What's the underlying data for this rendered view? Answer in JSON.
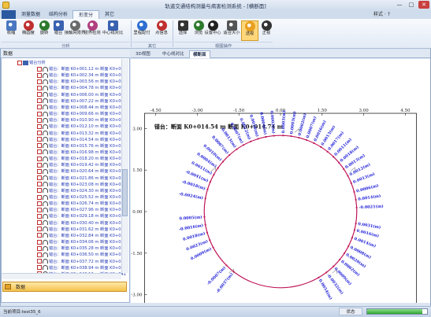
{
  "window": {
    "title": "轨道交通结构测量与病害检测系统 - [横断面]",
    "min_label": "—",
    "max_label": "□",
    "close_label": "✕"
  },
  "ribbon": {
    "file_tab": "",
    "tabs": [
      "测量数据",
      "结构分析",
      "形变分析",
      "其它"
    ],
    "active_tab": 2,
    "style_label": "样式 · ?",
    "groups": [
      "分析",
      "其它",
      "视图操作"
    ],
    "buttons": [
      {
        "label": "收缩",
        "icon": "shrink-icon",
        "color": "#4a78c0"
      },
      {
        "label": "椭圆度",
        "icon": "ellipse-icon",
        "color": "#c03030"
      },
      {
        "label": "旋转",
        "icon": "rotate-icon",
        "color": "#2d7a2d"
      },
      {
        "label": "错台",
        "icon": "offset-icon",
        "color": "#3a62b0"
      },
      {
        "label": "接触网限界",
        "icon": "catenary-icon",
        "color": "#6b6b6b"
      },
      {
        "label": "侵界检测",
        "icon": "clearance-icon",
        "color": "#b04080"
      },
      {
        "label": "中心线对比",
        "icon": "centerline-icon",
        "color": "#3a62b0"
      },
      {
        "label": "里程配付",
        "icon": "mileage-flag-icon",
        "color": "#2e6fd0"
      },
      {
        "label": "点信息",
        "icon": "point-info-icon",
        "color": "#c03030"
      },
      {
        "label": "选择",
        "icon": "select-cursor-icon",
        "color": "#333333"
      },
      {
        "label": "浏览",
        "icon": "pan-icon",
        "color": "#2d7a2d"
      },
      {
        "label": "设置中心",
        "icon": "set-center-icon",
        "color": "#222222"
      },
      {
        "label": "适合大小",
        "icon": "zoom-fit-icon",
        "color": "#555555"
      },
      {
        "label": "透视",
        "icon": "perspective-icon",
        "color": "#e8a020"
      },
      {
        "label": "正视",
        "icon": "front-view-icon",
        "color": "#333333"
      }
    ]
  },
  "left_panel": {
    "header": "数据",
    "root_label": "错台分析",
    "items": [
      "错台：断面 K0+001.12 m 断面 K0+002",
      "错台：断面 K0+002.34 m 断面 K0+003",
      "错台：断面 K0+003.56 m 断面 K0+004",
      "错台：断面 K0+004.78 m 断面 K0+006",
      "错台：断面 K0+006.00 m 断面 K0+007",
      "错台：断面 K0+007.22 m 断面 K0+008",
      "错台：断面 K0+008.44 m 断面 K0+009",
      "错台：断面 K0+009.66 m 断面 K0+010",
      "错台：断面 K0+010.90 m 断面 K0+012",
      "错台：断面 K0+012.10 m 断面 K0+013",
      "错台：断面 K0+013.32 m 断面 K0+014",
      "错台：断面 K0+014.54 m 断面 K0+015",
      "错台：断面 K0+015.76 m 断面 K0+016",
      "错台：断面 K0+016.98 m 断面 K0+018",
      "错台：断面 K0+018.20 m 断面 K0+019",
      "错台：断面 K0+019.42 m 断面 K0+020",
      "错台：断面 K0+020.64 m 断面 K0+021",
      "错台：断面 K0+021.86 m 断面 K0+023",
      "错台：断面 K0+023.08 m 断面 K0+024",
      "错台：断面 K0+024.30 m 断面 K0+025",
      "错台：断面 K0+025.52 m 断面 K0+026",
      "错台：断面 K0+026.74 m 断面 K0+027",
      "错台：断面 K0+027.96 m 断面 K0+029",
      "错台：断面 K0+029.18 m 断面 K0+030",
      "错台：断面 K0+030.40 m 断面 K0+031",
      "错台：断面 K0+031.62 m 断面 K0+032",
      "错台：断面 K0+032.84 m 断面 K0+034",
      "错台：断面 K0+034.06 m 断面 K0+035",
      "错台：断面 K0+035.28 m 断面 K0+036",
      "错台：断面 K0+036.50 m 断面 K0+037",
      "错台：断面 K0+037.72 m 断面 K0+038",
      "错台：断面 K0+038.94 m 断面 K0+040",
      "错台：断面 K0+040.16 m 断面 K0+041"
    ],
    "bottom_tab": "数据"
  },
  "doc_tabs": [
    "3D视图",
    "中心线对比",
    "横断面"
  ],
  "active_doc_tab": 2,
  "status": {
    "project": "当前项目:test35_6",
    "state_label": "状态",
    "progress": 0.92
  },
  "chart_data": {
    "type": "scatter",
    "title": "错台：断面 K0+014.54 m 断面 K0+014.74 m",
    "x_ticks": [
      -4.5,
      -3.0,
      -1.5,
      0.0,
      1.5,
      3.0,
      4.5
    ],
    "y_ticks": [
      3.0,
      1.5,
      0.0,
      -1.5,
      -3.0
    ],
    "xlim": [
      -4.9,
      4.9
    ],
    "ylim": [
      -3.55,
      3.55
    ],
    "ring_radius": 2.75,
    "label_color": "#1a1ad8",
    "ring_color": "#c0185a",
    "labels": [
      {
        "angle": 95,
        "text": "0.0002(m)"
      },
      {
        "angle": 88,
        "text": "0.0003(m)"
      },
      {
        "angle": 82,
        "text": "0.0003(m)"
      },
      {
        "angle": 76,
        "text": "0.0002(m)"
      },
      {
        "angle": 70,
        "text": "0.0007(m)"
      },
      {
        "angle": 64,
        "text": "0.0016(m)"
      },
      {
        "angle": 58,
        "text": "0.0013(m)"
      },
      {
        "angle": 52,
        "text": "0.0017(m)"
      },
      {
        "angle": 46,
        "text": "0.0011(m)"
      },
      {
        "angle": 40,
        "text": "0.0018(m)"
      },
      {
        "angle": 34,
        "text": "0.0013(m)"
      },
      {
        "angle": 28,
        "text": "0.0012(m)"
      },
      {
        "angle": 22,
        "text": "0.0013(m)"
      },
      {
        "angle": 15,
        "text": "0.0006(m)"
      },
      {
        "angle": 9,
        "text": "0.0014(m)"
      },
      {
        "angle": 3,
        "text": "-0.0021(m)"
      },
      {
        "angle": -9,
        "text": "0.0031(m)"
      },
      {
        "angle": -14,
        "text": "0.0016(m)"
      },
      {
        "angle": -20,
        "text": "0.0014(m)"
      },
      {
        "angle": -27,
        "text": "0.0008(m)"
      },
      {
        "angle": -33,
        "text": "0.0020(m)"
      },
      {
        "angle": -39,
        "text": "0.0002(m)"
      },
      {
        "angle": -46,
        "text": "0.0009(m)"
      },
      {
        "angle": -53,
        "text": "-0.0032(m)"
      },
      {
        "angle": -60,
        "text": "0.0054(m)"
      },
      {
        "angle": 101,
        "text": "0.0004(m)"
      },
      {
        "angle": 107,
        "text": "0.0018(m)"
      },
      {
        "angle": 113,
        "text": "0.0012(m)"
      },
      {
        "angle": 119,
        "text": "0.0007(m)"
      },
      {
        "angle": 125,
        "text": "0.0013(m)"
      },
      {
        "angle": 132,
        "text": "0.0007(m)"
      },
      {
        "angle": 139,
        "text": "0.0010(m)"
      },
      {
        "angle": 145,
        "text": "0.0004(m)"
      },
      {
        "angle": 151,
        "text": "0.0011(m)"
      },
      {
        "angle": 157,
        "text": "-0.0041(m)"
      },
      {
        "angle": 163,
        "text": "-0.0018(m)"
      },
      {
        "angle": 170,
        "text": "-0.0024(m)"
      },
      {
        "angle": 184,
        "text": "0.0005(m)"
      },
      {
        "angle": 190,
        "text": "-0.0016(m)"
      },
      {
        "angle": 196,
        "text": "0.0018(m)"
      },
      {
        "angle": 202,
        "text": "0.0023(m)"
      },
      {
        "angle": 208,
        "text": "0.0009(m)"
      },
      {
        "angle": 225,
        "text": "-0.0007(m)"
      },
      {
        "angle": 232,
        "text": "-0.0037(m)"
      }
    ]
  }
}
